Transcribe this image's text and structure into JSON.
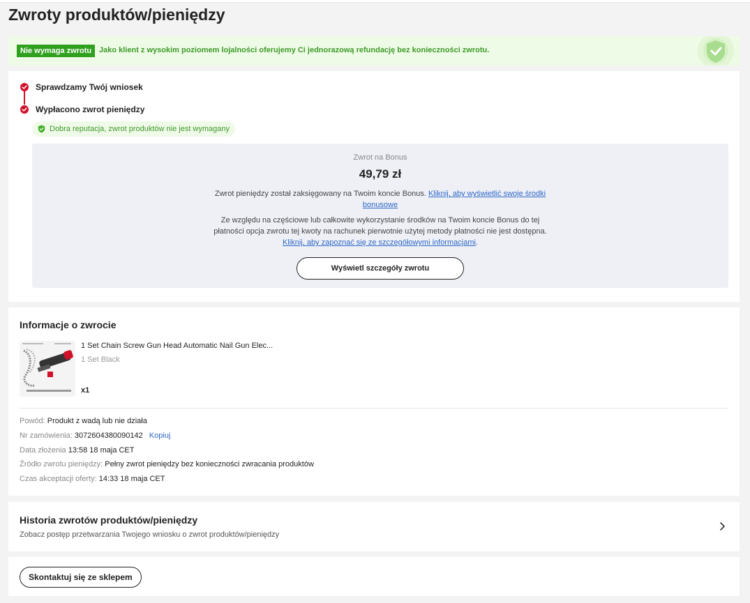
{
  "page": {
    "title": "Zwroty produktów/pieniędzy"
  },
  "banner": {
    "tag": "Nie wymaga zwrotu",
    "message": "Jako klient z wysokim poziomem lojalności oferujemy Ci jednorazową refundację bez konieczności zwrotu."
  },
  "status": {
    "steps": [
      {
        "label": "Sprawdzamy Twój wniosek"
      },
      {
        "label": "Wypłacono zwrot pieniędzy"
      }
    ],
    "reputation": "Dobra reputacja, zwrot produktów nie jest wymagany"
  },
  "refund": {
    "subtitle": "Zwrot na Bonus",
    "amount": "49,79 zł",
    "para1_text": "Zwrot pieniędzy został zaksięgowany na Twoim koncie Bonus.",
    "para1_link": "Kliknij, aby wyświetlić swoje środki bonusowe",
    "para2_text": "Ze względu na częściowe lub całkowite wykorzystanie środków na Twoim koncie Bonus do tej płatności opcja zwrotu tej kwoty na rachunek pierwotnie użytej metody płatności nie jest dostępna.",
    "para2_link": "Kliknij, aby zapoznać się ze szczegółowymi informacjami",
    "para2_end": ".",
    "details_button": "Wyświetl szczegóły zwrotu"
  },
  "info": {
    "title": "Informacje o zwrocie",
    "product": {
      "name": "1 Set Chain Screw Gun Head Automatic Nail Gun Elec...",
      "variant": "1 Set Black",
      "quantity": "x1"
    },
    "reason_label": "Powód:",
    "reason_value": "Produkt z wadą lub nie działa",
    "order_label": "Nr zamówienia:",
    "order_value": "3072604380090142",
    "copy_label": "Kopiuj",
    "date_label": "Data złożenia",
    "date_value": "13:58 18 maja CET",
    "source_label": "Źródło zwrotu pieniędzy:",
    "source_value": "Pełny zwrot pieniędzy bez konieczności zwracania produktów",
    "accept_label": "Czas akceptacji oferty:",
    "accept_value": "14:33 18 maja CET"
  },
  "history": {
    "title": "Historia zwrotów produktów/pieniędzy",
    "subtitle": "Zobacz postęp przetwarzania Twojego wniosku o zwrot produktów/pieniędzy"
  },
  "contact": {
    "button": "Skontaktuj się ze sklepem"
  },
  "colors": {
    "accent_red": "#d0112b",
    "green": "#3f9a2a",
    "tag_green": "#2fa11e",
    "link_blue": "#2e67c8"
  }
}
